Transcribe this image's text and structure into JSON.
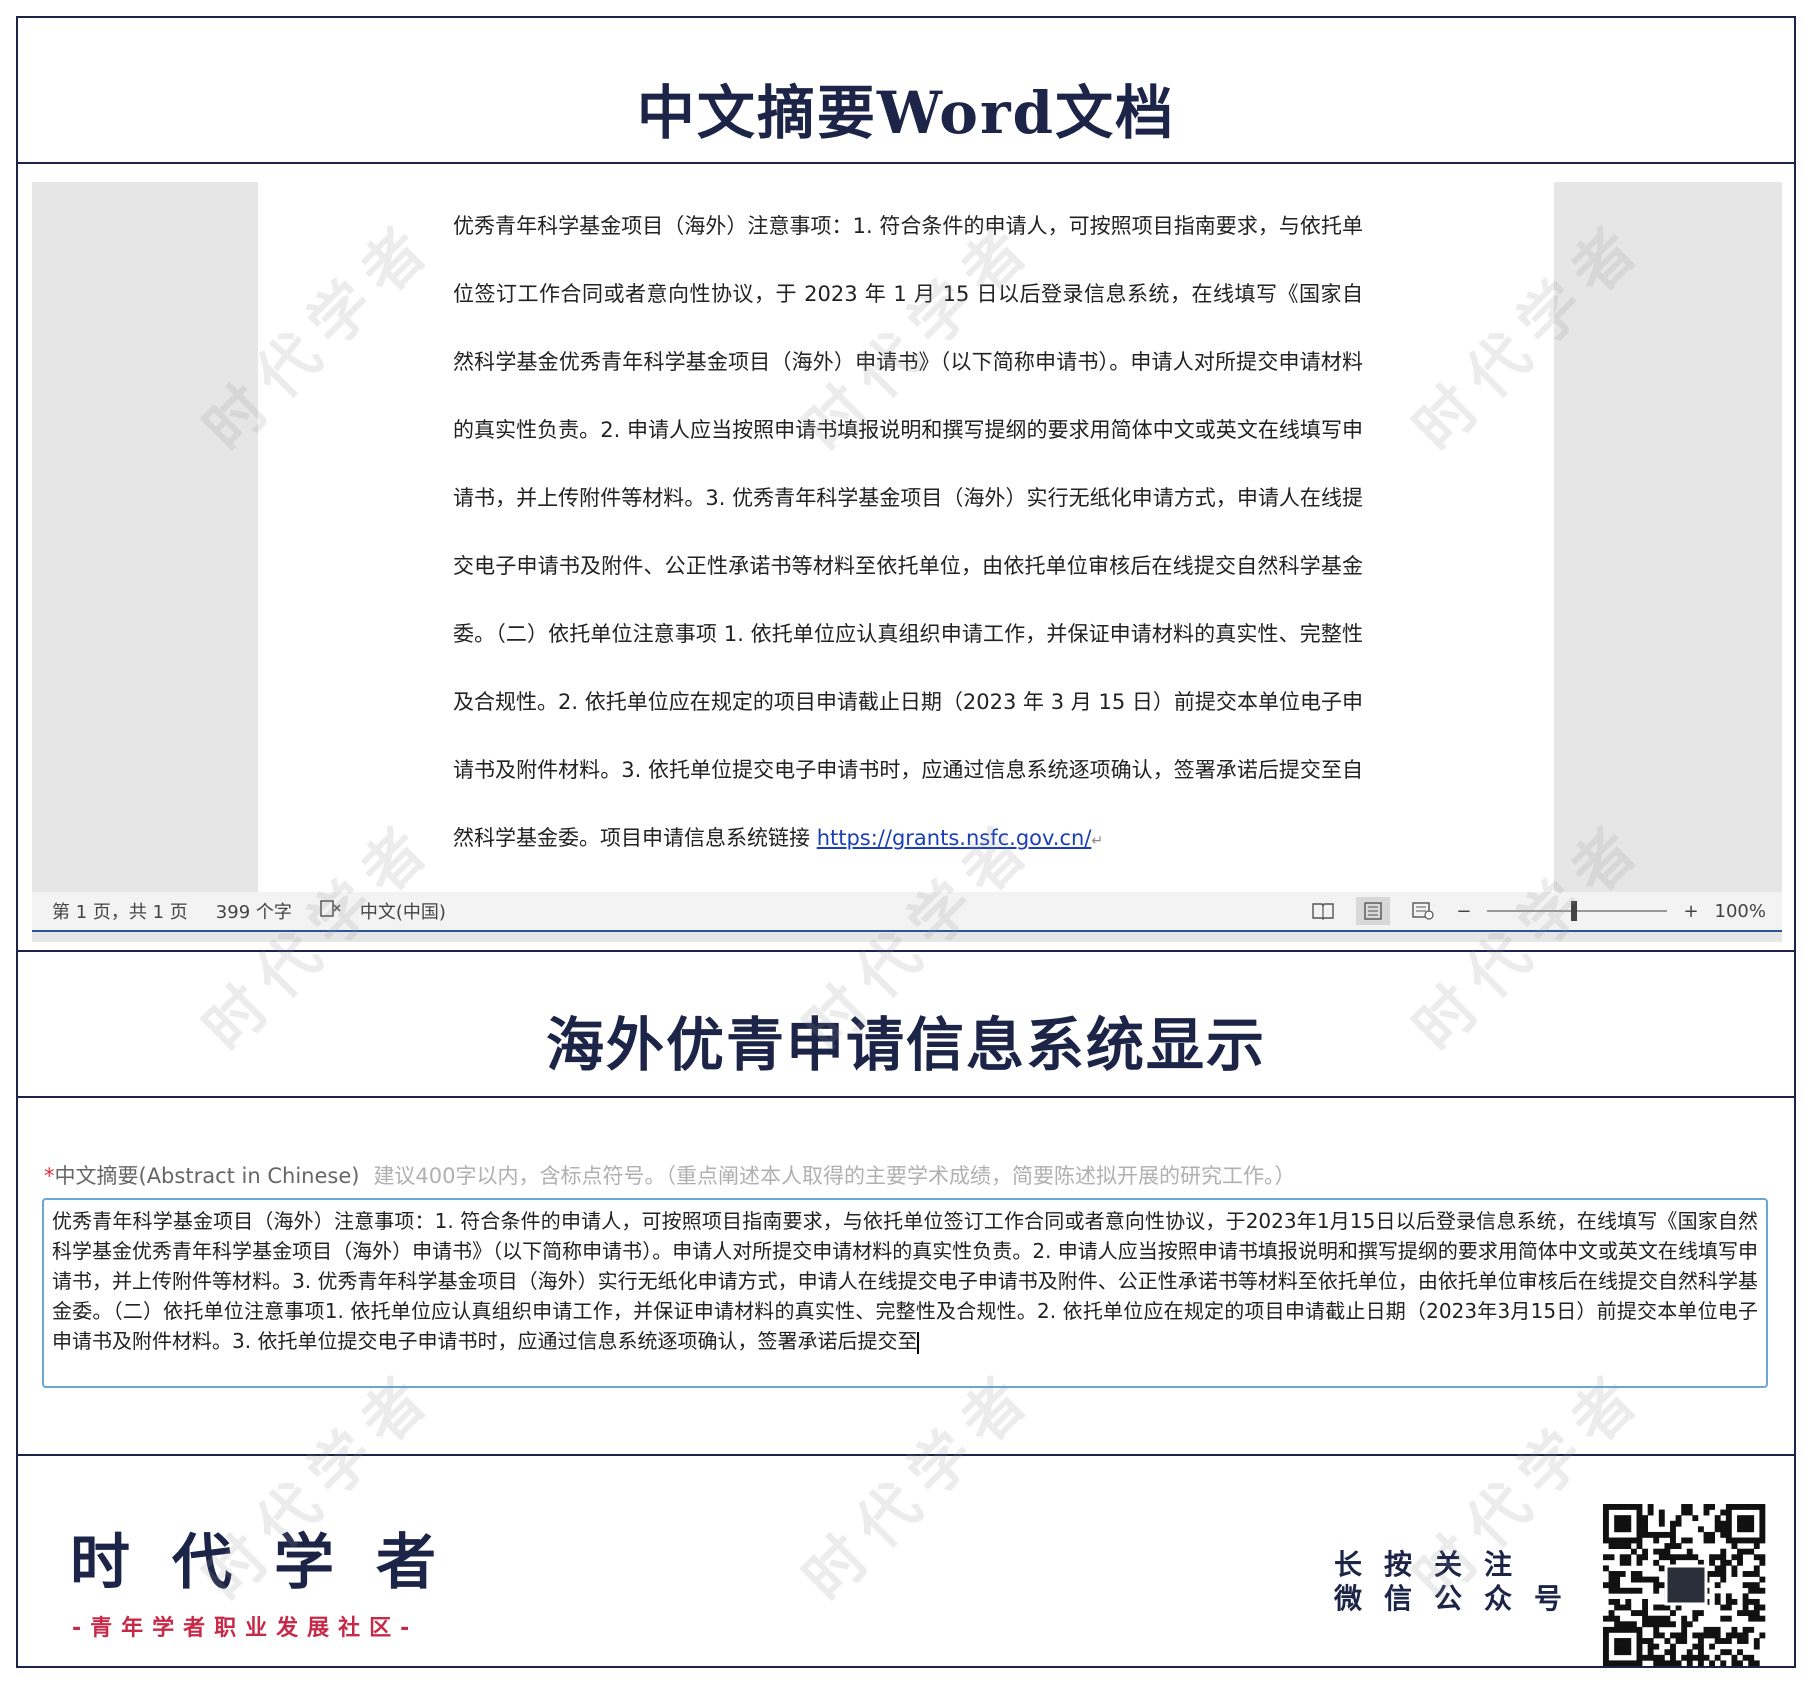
{
  "sections": {
    "word_title": "中文摘要Word文档",
    "system_title": "海外优青申请信息系统显示"
  },
  "word_doc": {
    "body": "优秀青年科学基金项目（海外）注意事项：1. 符合条件的申请人，可按照项目指南要求，与依托单位签订工作合同或者意向性协议，于 2023 年 1 月 15 日以后登录信息系统，在线填写《国家自然科学基金优秀青年科学基金项目（海外）申请书》（以下简称申请书）。申请人对所提交申请材料的真实性负责。2. 申请人应当按照申请书填报说明和撰写提纲的要求用简体中文或英文在线填写申请书，并上传附件等材料。3. 优秀青年科学基金项目（海外）实行无纸化申请方式，申请人在线提交电子申请书及附件、公正性承诺书等材料至依托单位，由依托单位审核后在线提交自然科学基金委。（二）依托单位注意事项 1. 依托单位应认真组织申请工作，并保证申请材料的真实性、完整性及合规性。2. 依托单位应在规定的项目申请截止日期（2023 年 3 月 15 日）前提交本单位电子申请书及附件材料。3. 依托单位提交电子申请书时，应通过信息系统逐项确认，签署承诺后提交至自然科学基金委。项目申请信息系统链接 ",
    "link": "https://grants.nsfc.gov.cn/",
    "para_mark": "↵"
  },
  "statusbar": {
    "page_info": "第 1 页，共 1 页",
    "word_count": "399 个字",
    "language": "中文(中国)",
    "zoom_minus": "−",
    "zoom_plus": "+",
    "zoom_level": "100%"
  },
  "form": {
    "required_mark": "*",
    "label": "中文摘要(Abstract in Chinese)",
    "hint": "建议400字以内，含标点符号。（重点阐述本人取得的主要学术成绩，简要陈述拟开展的研究工作。）",
    "value": "优秀青年科学基金项目（海外）注意事项：1. 符合条件的申请人，可按照项目指南要求，与依托单位签订工作合同或者意向性协议，于2023年1月15日以后登录信息系统，在线填写《国家自然科学基金优秀青年科学基金项目（海外）申请书》（以下简称申请书）。申请人对所提交申请材料的真实性负责。2. 申请人应当按照申请书填报说明和撰写提纲的要求用简体中文或英文在线填写申请书，并上传附件等材料。3. 优秀青年科学基金项目（海外）实行无纸化申请方式，申请人在线提交电子申请书及附件、公正性承诺书等材料至依托单位，由依托单位审核后在线提交自然科学基金委。（二）依托单位注意事项1. 依托单位应认真组织申请工作，并保证申请材料的真实性、完整性及合规性。2. 依托单位应在规定的项目申请截止日期（2023年3月15日）前提交本单位电子申请书及附件材料。3. 依托单位提交电子申请书时，应通过信息系统逐项确认，签署承诺后提交至"
  },
  "footer": {
    "brand": "时代学者",
    "tagline": "-青年学者职业发展社区-",
    "follow_line1": "长按关注",
    "follow_line2": "微信公众号"
  },
  "watermark_text": "时代学者"
}
